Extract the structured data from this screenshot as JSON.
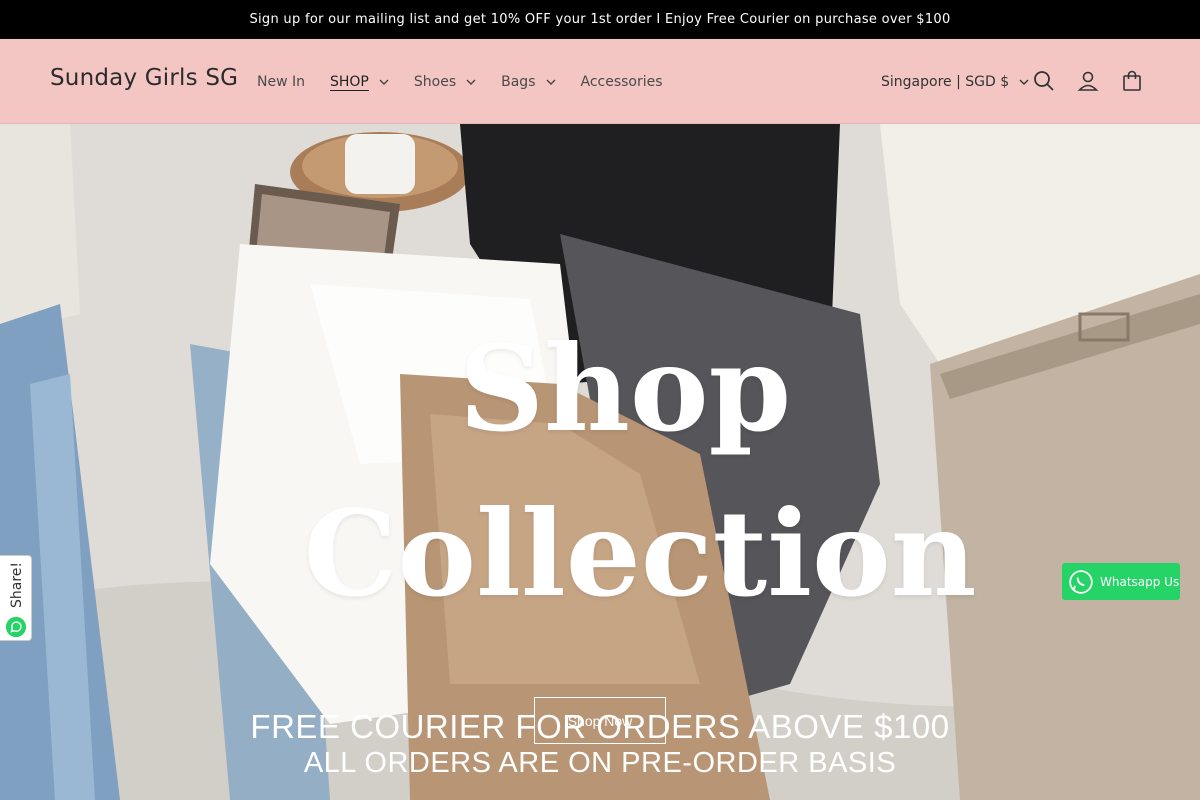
{
  "announcement": {
    "text": "Sign up for our mailing list and get 10% OFF your 1st order I Enjoy Free Courier on purchase over $100"
  },
  "header": {
    "logo": "Sunday Girls SG",
    "nav": [
      {
        "label": "New In",
        "has_dropdown": false
      },
      {
        "label": "SHOP",
        "has_dropdown": true,
        "active": true
      },
      {
        "label": "Shoes",
        "has_dropdown": true
      },
      {
        "label": "Bags",
        "has_dropdown": true
      },
      {
        "label": "Accessories",
        "has_dropdown": false
      }
    ],
    "currency": "Singapore | SGD $",
    "icons": [
      "search-icon",
      "account-icon",
      "cart-icon"
    ]
  },
  "hero": {
    "title_line1": "Shop",
    "title_line2": "Collection",
    "promo_line1": "FREE COURIER FOR ORDERS ABOVE $100",
    "promo_line2": "ALL ORDERS ARE ON PRE-ORDER BASIS",
    "button_label": "Shop Now"
  },
  "share": {
    "label": "Share!"
  },
  "whatsapp": {
    "label": "Whatsapp Us"
  },
  "colors": {
    "header_bg": "#f3c6c4",
    "announcement_bg": "#000000",
    "whatsapp_green": "#25d366"
  }
}
